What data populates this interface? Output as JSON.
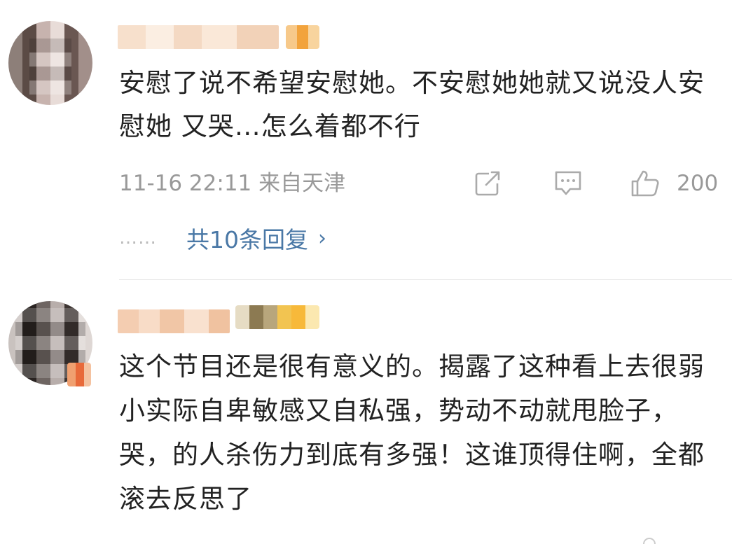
{
  "comments": [
    {
      "text": "安慰了说不希望安慰她。不安慰她她就又说没人安慰她 又哭…怎么着都不行",
      "time_location": "11-16 22:11  来自天津",
      "like_count": "200",
      "replies_label": "共10条回复",
      "dots": "……"
    },
    {
      "text": "这个节目还是很有意义的。揭露了这种看上去很弱小实际自卑敏感又自私强，势动不动就甩脸子，哭，的人杀伤力到底有多强！这谁顶得住啊，全都滚去反思了"
    }
  ],
  "icons": {
    "share": "share-icon",
    "reply": "comment-icon",
    "like": "thumbs-up-icon",
    "more": "chevron-right-icon"
  },
  "colors": {
    "text": "#222222",
    "meta": "#999999",
    "link": "#4a78a6",
    "divider": "#e6e6e6"
  }
}
